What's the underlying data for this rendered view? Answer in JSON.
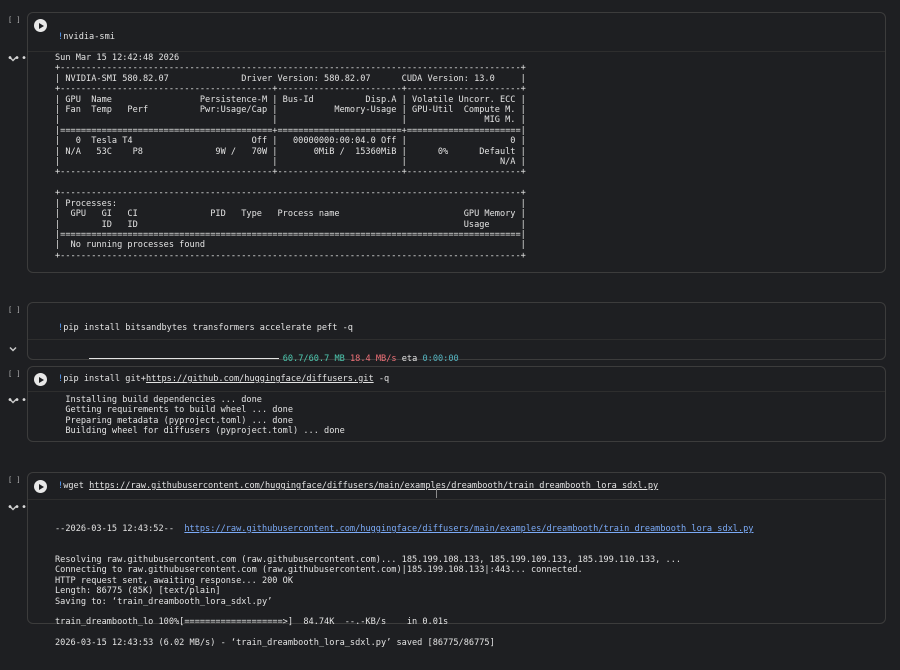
{
  "cells": [
    {
      "exec_count": "[ ]",
      "code_bang": "!",
      "code_text": "nvidia-smi",
      "output_lines": [
        "Sun Mar 15 12:42:48 2026",
        "+-----------------------------------------------------------------------------------------+",
        "| NVIDIA-SMI 580.82.07              Driver Version: 580.82.07      CUDA Version: 13.0     |",
        "+-----------------------------------------+------------------------+----------------------+",
        "| GPU  Name                 Persistence-M | Bus-Id          Disp.A | Volatile Uncorr. ECC |",
        "| Fan  Temp   Perf          Pwr:Usage/Cap |           Memory-Usage | GPU-Util  Compute M. |",
        "|                                         |                        |               MIG M. |",
        "|=========================================+========================+======================|",
        "|   0  Tesla T4                       Off |   00000000:00:04.0 Off |                    0 |",
        "| N/A   53C    P8              9W /   70W |       0MiB /  15360MiB |      0%      Default |",
        "|                                         |                        |                  N/A |",
        "+-----------------------------------------+------------------------+----------------------+",
        "",
        "+-----------------------------------------------------------------------------------------+",
        "| Processes:                                                                              |",
        "|  GPU   GI   CI              PID   Type   Process name                        GPU Memory |",
        "|        ID   ID                                                               Usage      |",
        "|=========================================================================================|",
        "|  No running processes found                                                             |",
        "+-----------------------------------------------------------------------------------------+"
      ]
    },
    {
      "exec_count": "[ ]",
      "code_bang": "!",
      "code_text": "pip install bitsandbytes transformers accelerate peft -q",
      "progress_fraction": 1.0,
      "progress_size": "60.7/60.7 MB",
      "progress_speed": "18.4 MB/s",
      "progress_eta_label": "eta",
      "progress_eta": "0:00:00"
    },
    {
      "exec_count": "[ ]",
      "code_bang": "!",
      "code_prefix": "pip install git+",
      "code_url": "https://github.com/huggingface/diffusers.git",
      "code_suffix": " -q",
      "output_lines": [
        "  Installing build dependencies ... done",
        "  Getting requirements to build wheel ... done",
        "  Preparing metadata (pyproject.toml) ... done",
        "  Building wheel for diffusers (pyproject.toml) ... done"
      ]
    },
    {
      "exec_count": "[ ]",
      "code_bang": "!",
      "code_prefix": "wget ",
      "code_url": "https://raw.githubusercontent.com/huggingface/diffusers/main/examples/dreambooth/train_dreambooth_lora_sdxl.py",
      "output_first_prefix": "--2026-03-15 12:43:52--  ",
      "output_first_url": "https://raw.githubusercontent.com/huggingface/diffusers/main/examples/dreambooth/train_dreambooth_lora_sdxl.py",
      "output_lines": [
        "Resolving raw.githubusercontent.com (raw.githubusercontent.com)... 185.199.108.133, 185.199.109.133, 185.199.110.133, ...",
        "Connecting to raw.githubusercontent.com (raw.githubusercontent.com)|185.199.108.133|:443... connected.",
        "HTTP request sent, awaiting response... 200 OK",
        "Length: 86775 (85K) [text/plain]",
        "Saving to: ‘train_dreambooth_lora_sdxl.py’",
        "",
        "train_dreambooth_lo 100%[===================>]  84.74K  --.-KB/s    in 0.01s",
        "",
        "2026-03-15 12:43:53 (6.02 MB/s) - ‘train_dreambooth_lora_sdxl.py’ saved [86775/86775]"
      ]
    }
  ]
}
